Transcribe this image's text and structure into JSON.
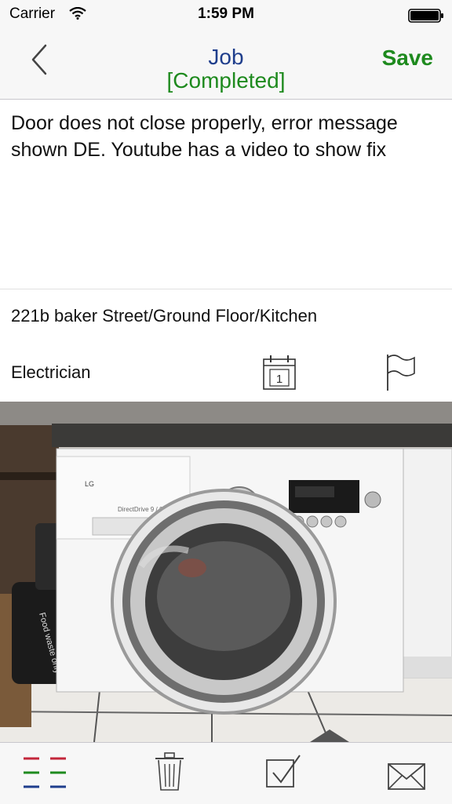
{
  "status_bar": {
    "carrier": "Carrier",
    "time": "1:59 PM",
    "wifi_icon": "wifi-icon",
    "battery_icon": "battery-icon"
  },
  "nav": {
    "back_icon": "chevron-left-icon",
    "title": "Job",
    "status": "[Completed]",
    "save_label": "Save"
  },
  "job": {
    "description": "Door does not close properly, error message shown DE. Youtube has a video to show fix",
    "location": "221b baker Street/Ground Floor/Kitchen",
    "trade": "Electrician",
    "calendar_day": "1",
    "calendar_icon": "calendar-icon",
    "flag_icon": "flag-icon"
  },
  "photo": {
    "subject": "washing-machine-photo",
    "appliance_logo": "LG",
    "model_text": "DirectDrive 9 / 6kg",
    "bin_label": "Food waste only"
  },
  "toolbar": {
    "items": [
      {
        "icon": "list-icon"
      },
      {
        "icon": "trash-icon"
      },
      {
        "icon": "checkbox-icon"
      },
      {
        "icon": "mail-icon"
      }
    ]
  },
  "colors": {
    "title": "#1f3e8c",
    "completed": "#1e8a1e",
    "save": "#1e8a1e",
    "bar_background": "#f7f7f7"
  }
}
